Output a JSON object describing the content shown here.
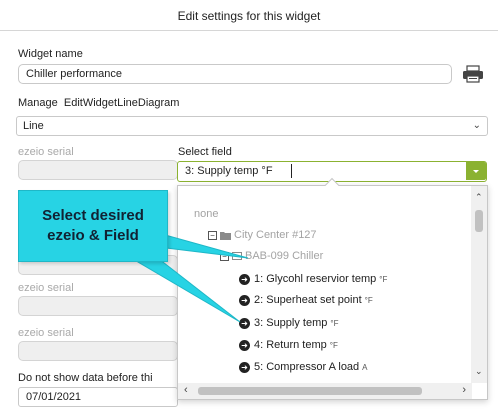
{
  "dialog": {
    "title": "Edit settings for this widget"
  },
  "widget_name": {
    "label": "Widget name",
    "value": "Chiller performance"
  },
  "manage": {
    "label": "Manage",
    "link": "EditWidgetLineDiagram"
  },
  "chart_type": {
    "value": "Line"
  },
  "ezeio_serial_labels": [
    "ezeio serial",
    "ezeio serial",
    "ezeio serial"
  ],
  "select_field": {
    "label": "Select field",
    "value": "3: Supply temp °F"
  },
  "date_filter": {
    "label": "Do not show data before thi",
    "value": "07/01/2021"
  },
  "dropdown": {
    "none": "none",
    "group": "City Center #127",
    "device": "BAB-099 Chiller",
    "fields": [
      {
        "label": "1: Glycohl reservior temp",
        "unit": "°F"
      },
      {
        "label": "2: Superheat set point",
        "unit": "°F"
      },
      {
        "label": "3: Supply temp",
        "unit": "°F"
      },
      {
        "label": "4: Return temp",
        "unit": "°F"
      },
      {
        "label": "5: Compressor A load",
        "unit": "A"
      }
    ]
  },
  "callout": {
    "line1": "Select desired",
    "line2": "ezeio & Field",
    "color": "#27d3e4"
  },
  "accent_color": "#8bb231",
  "icons": {
    "print": "printer-icon",
    "collapse": "minus-box-icon",
    "folder": "folder-icon",
    "device": "box-icon",
    "field": "arrow-circle-icon"
  }
}
